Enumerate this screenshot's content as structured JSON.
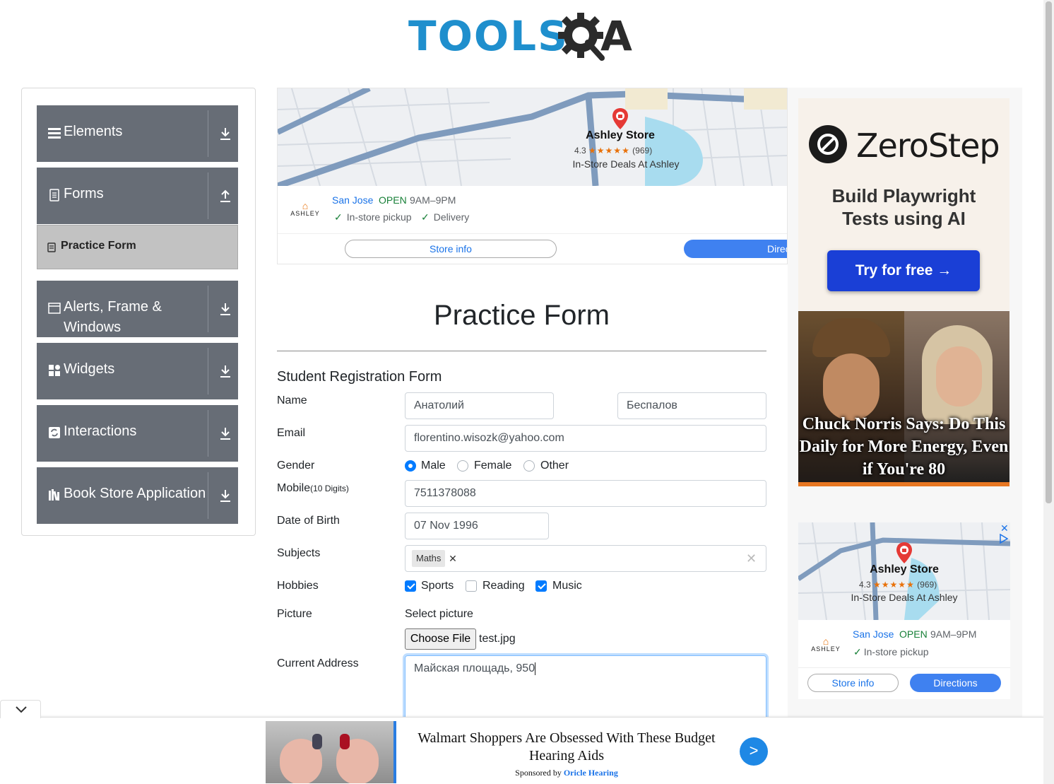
{
  "logo": {
    "text": "TOOLS",
    "a_letter": "A",
    "alt": "TOOLSQA"
  },
  "sidebar": {
    "groups": [
      {
        "label": "Elements",
        "icon": "hamburger-icon"
      },
      {
        "label": "Forms",
        "icon": "document-icon",
        "expanded": true
      },
      {
        "label": "Alerts, Frame &",
        "label2": "Windows",
        "icon": "window-icon"
      },
      {
        "label": "Widgets",
        "icon": "grid-icon"
      },
      {
        "label": "Interactions",
        "icon": "interaction-icon"
      },
      {
        "label": "Book Store Application",
        "icon": "books-icon"
      }
    ],
    "active_item": "Practice Form"
  },
  "ad_top": {
    "store": "Ashley Store",
    "rating": "4.3",
    "stars": "★★★★★",
    "reviews": "(969)",
    "deal": "In-Store Deals At Ashley",
    "brand": "ASHLEY",
    "city": "San Jose",
    "status": "OPEN",
    "hours": "9AM–9PM",
    "feature1": "In-store pickup",
    "feature2": "Delivery",
    "store_info": "Store info",
    "directions": "Directions"
  },
  "ad_right": {
    "brand": "ZeroStep",
    "tagline1": "Build Playwright",
    "tagline2": "Tests using AI",
    "cta": "Try for free →",
    "headline": "Chuck Norris Says: Do This Daily for More Energy, Even if You're 80",
    "store": "Ashley Store",
    "rating": "4.3",
    "reviews": "(969)",
    "deal": "In-Store Deals At Ashley",
    "city": "San Jose",
    "status": "OPEN",
    "hours": "9AM–9PM",
    "feature1": "In-store pickup",
    "store_info": "Store info",
    "directions": "Directions",
    "close": "✕"
  },
  "form": {
    "title": "Practice Form",
    "subtitle": "Student Registration Form",
    "labels": {
      "name": "Name",
      "email": "Email",
      "gender": "Gender",
      "mobile": "Mobile",
      "mobile_hint": "(10 Digits)",
      "dob": "Date of Birth",
      "subjects": "Subjects",
      "hobbies": "Hobbies",
      "picture": "Picture",
      "address": "Current Address"
    },
    "first_name": "Анатолий",
    "last_name": "Беспалов",
    "email": "florentino.wisozk@yahoo.com",
    "gender_options": [
      "Male",
      "Female",
      "Other"
    ],
    "gender_selected": "Male",
    "mobile": "7511378088",
    "dob": "07 Nov 1996",
    "subjects": [
      "Maths"
    ],
    "hobbies": [
      {
        "label": "Sports",
        "checked": true
      },
      {
        "label": "Reading",
        "checked": false
      },
      {
        "label": "Music",
        "checked": true
      }
    ],
    "picture_prompt": "Select picture",
    "choose_file": "Choose File",
    "file_name": "test.jpg",
    "address": "Майская площадь, 950"
  },
  "bottom_ad": {
    "title": "Walmart Shoppers Are Obsessed With These Budget Hearing Aids",
    "sponsored_by": "Sponsored by",
    "sponsor": "Oricle Hearing",
    "go": ">"
  },
  "colors": {
    "sidebar": "#676d76",
    "primary": "#007bff",
    "logo_blue": "#1f8fcd",
    "zerostep_button": "#1a3fd6"
  }
}
